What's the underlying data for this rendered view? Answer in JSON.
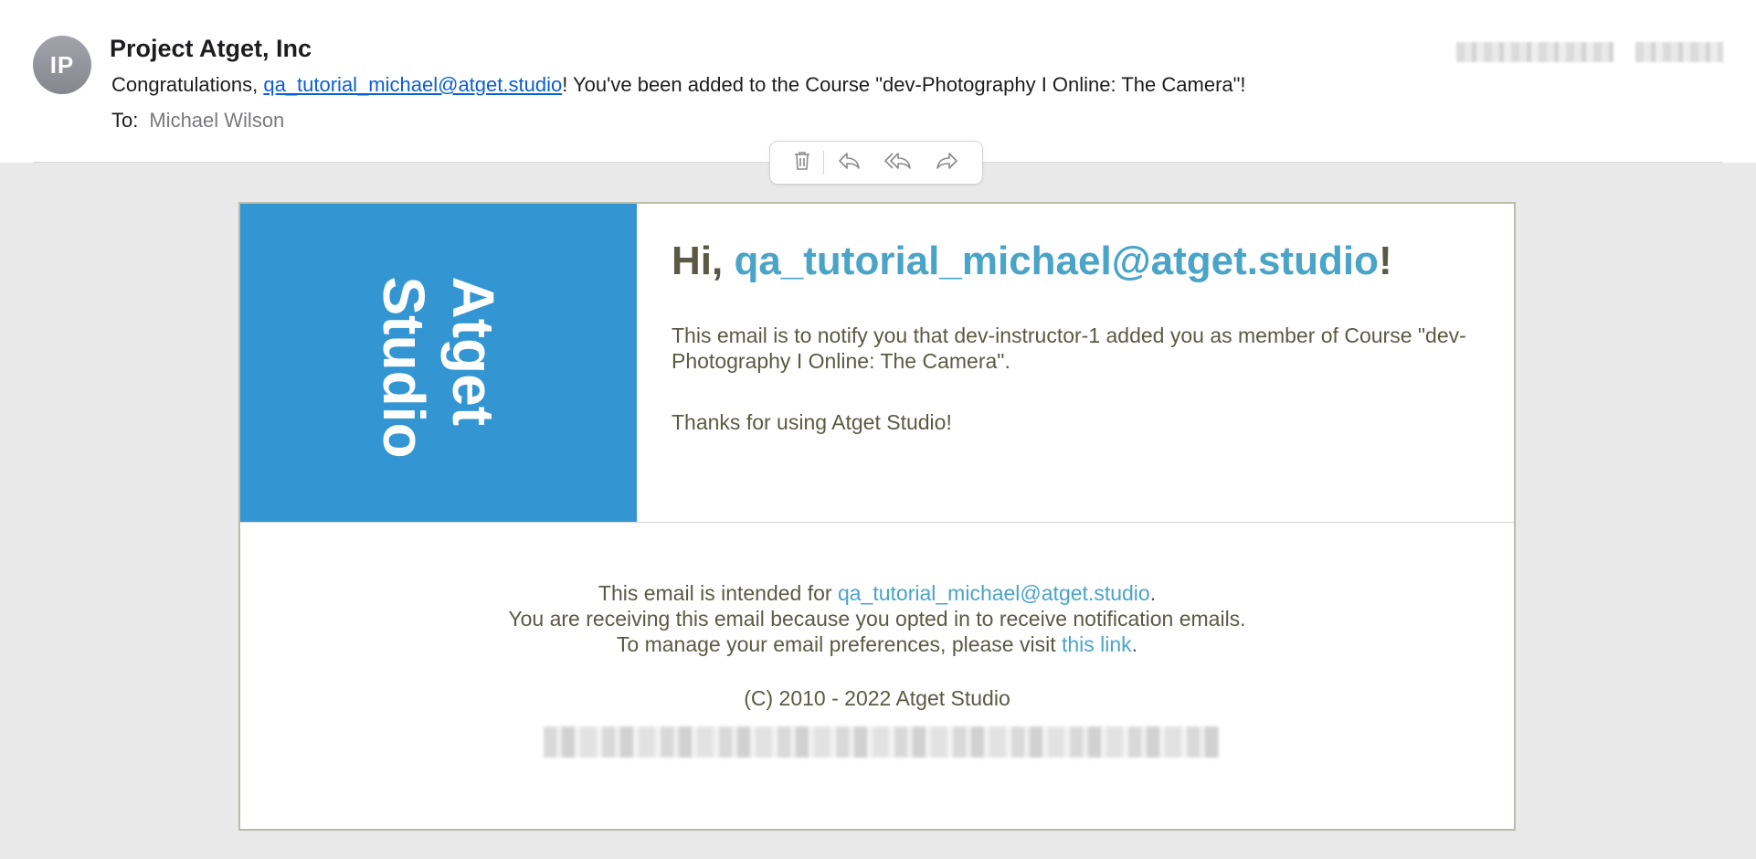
{
  "header": {
    "avatar_initials": "IP",
    "sender": "Project Atget, Inc",
    "subject_prefix": "Congratulations, ",
    "subject_email": "qa_tutorial_michael@atget.studio",
    "subject_suffix": "!  You've been added to the Course \"dev-Photography I Online: The Camera\"!",
    "to_label": "To:",
    "to_name": "Michael Wilson"
  },
  "toolbar": {
    "icons": [
      "trash-icon",
      "reply-icon",
      "reply-all-icon",
      "forward-icon"
    ]
  },
  "email": {
    "logo_line1": "Atget",
    "logo_line2": "Studio",
    "logo_color": "#3396d2",
    "greeting_prefix": "Hi, ",
    "greeting_email": "qa_tutorial_michael@atget.studio",
    "greeting_suffix": "!",
    "notice": "This email is to notify you that dev-instructor-1 added you as member of Course \"dev-Photography I Online: The Camera\".",
    "thanks": "Thanks for using Atget Studio!",
    "footer_intended_prefix": "This email is intended for ",
    "footer_intended_email": "qa_tutorial_michael@atget.studio",
    "footer_intended_suffix": ".",
    "footer_reason": "You are receiving this email because you opted in to receive notification emails.",
    "footer_manage_prefix": "To manage your email preferences, please visit ",
    "footer_manage_link": "this link",
    "footer_manage_suffix": ".",
    "copyright": "(C) 2010 - 2022 Atget Studio"
  },
  "colors": {
    "link_blue": "#0a5fd6",
    "accent": "#4aa4c8",
    "text_olive": "#5a5a44"
  }
}
